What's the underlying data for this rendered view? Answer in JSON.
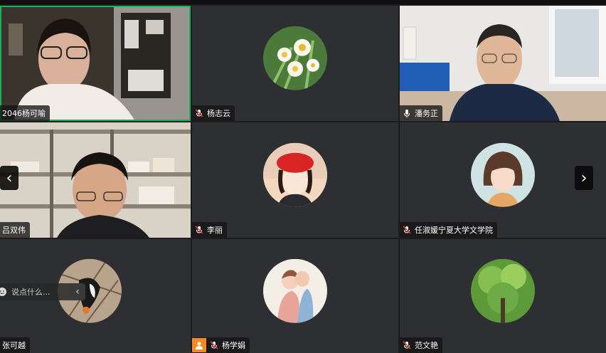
{
  "participants": [
    {
      "name": "2046杨可喻",
      "mic": "none"
    },
    {
      "name": "杨志云",
      "mic": "muted"
    },
    {
      "name": "潘务正",
      "mic": "on"
    },
    {
      "name": "吕双伟",
      "mic": "none"
    },
    {
      "name": "李丽",
      "mic": "muted"
    },
    {
      "name": "任淑媛宁夏大学文学院",
      "mic": "muted"
    },
    {
      "name": "张可越",
      "mic": "none"
    },
    {
      "name": "杨学娟",
      "mic": "muted"
    },
    {
      "name": "范文艳",
      "mic": "muted"
    }
  ],
  "chat": {
    "placeholder": "说点什么..."
  },
  "nav": {
    "left": "‹",
    "right": "›"
  },
  "colors": {
    "active_border": "#18b45b",
    "tile_bg": "#2d2f33",
    "badge": "#f48a24"
  }
}
